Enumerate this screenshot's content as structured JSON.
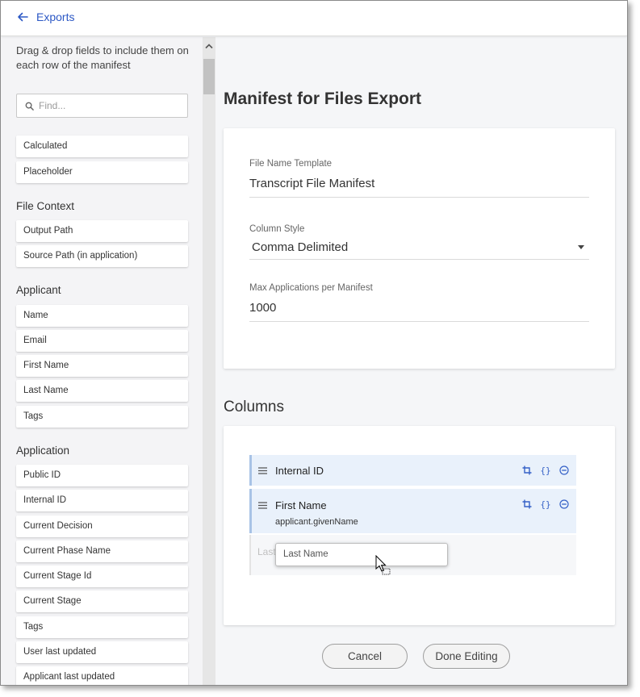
{
  "header": {
    "back_label": "Exports"
  },
  "sidebar": {
    "hint": "Drag & drop fields to include them on each row of the manifest",
    "search_placeholder": "Find...",
    "ungrouped": [
      "Calculated",
      "Placeholder"
    ],
    "groups": [
      {
        "heading": "File Context",
        "items": [
          "Output Path",
          "Source Path (in application)"
        ]
      },
      {
        "heading": "Applicant",
        "items": [
          "Name",
          "Email",
          "First Name",
          "Last Name",
          "Tags"
        ]
      },
      {
        "heading": "Application",
        "items": [
          "Public ID",
          "Internal ID",
          "Current Decision",
          "Current Phase Name",
          "Current Stage Id",
          "Current Stage",
          "Tags",
          "User last updated",
          "Applicant last updated"
        ]
      }
    ]
  },
  "main": {
    "title": "Manifest for Files Export",
    "settings": {
      "file_name_label": "File Name Template",
      "file_name_value": "Transcript File Manifest",
      "column_style_label": "Column Style",
      "column_style_value": "Comma Delimited",
      "max_apps_label": "Max Applications per Manifest",
      "max_apps_value": "1000"
    },
    "columns_title": "Columns",
    "columns": [
      {
        "name": "Internal ID",
        "sub": ""
      },
      {
        "name": "First Name",
        "sub": "applicant.givenName"
      }
    ],
    "drop_placeholder": "Last",
    "dragging_chip": "Last Name"
  },
  "footer": {
    "cancel_label": "Cancel",
    "done_label": "Done Editing"
  },
  "colors": {
    "accent": "#2c58c5",
    "column_bg": "#e9f1fb",
    "panel_bg": "#f5f6f8"
  }
}
